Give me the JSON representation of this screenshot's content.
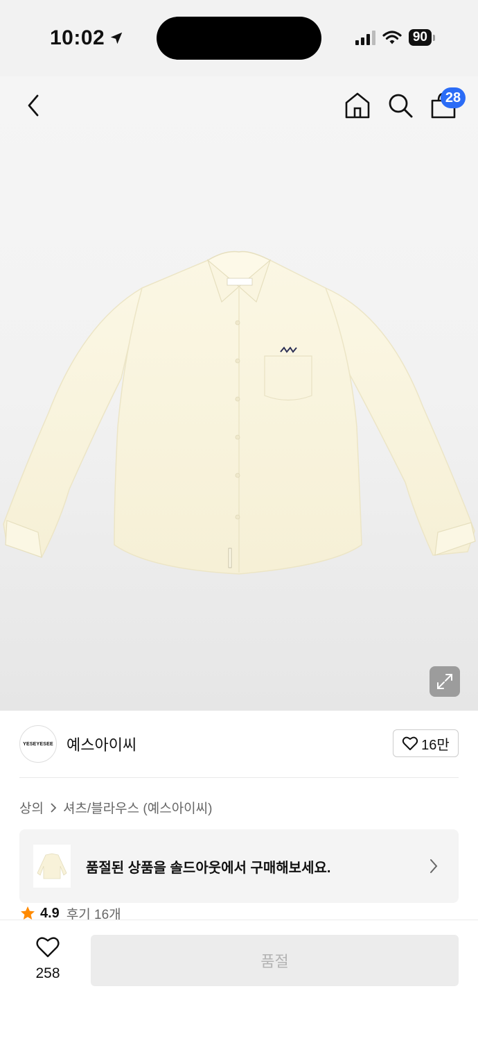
{
  "status_bar": {
    "time": "10:02",
    "battery": "90"
  },
  "nav": {
    "back_icon": "chevron-left-icon",
    "home_icon": "home-icon",
    "search_icon": "search-icon",
    "cart_icon": "shopping-bag-icon",
    "cart_count": "28"
  },
  "product": {
    "image": "cream-button-down-shirt",
    "zoom_icon": "expand-icon"
  },
  "brand": {
    "logo_text": "YESEYESEE",
    "name": "예스아이씨",
    "like_count": "16만"
  },
  "breadcrumb": {
    "items": [
      "상의",
      "셔츠/블라우스 (예스아이씨)"
    ]
  },
  "soldout_banner": {
    "text": "품절된 상품을 솔드아웃에서 구매해보세요."
  },
  "rating": {
    "score": "4.9",
    "reviews": "후기 16개"
  },
  "bottom_bar": {
    "wish_count": "258",
    "button_label": "품절"
  },
  "colors": {
    "accent": "#2b6cf6",
    "star": "#ff8a00"
  }
}
